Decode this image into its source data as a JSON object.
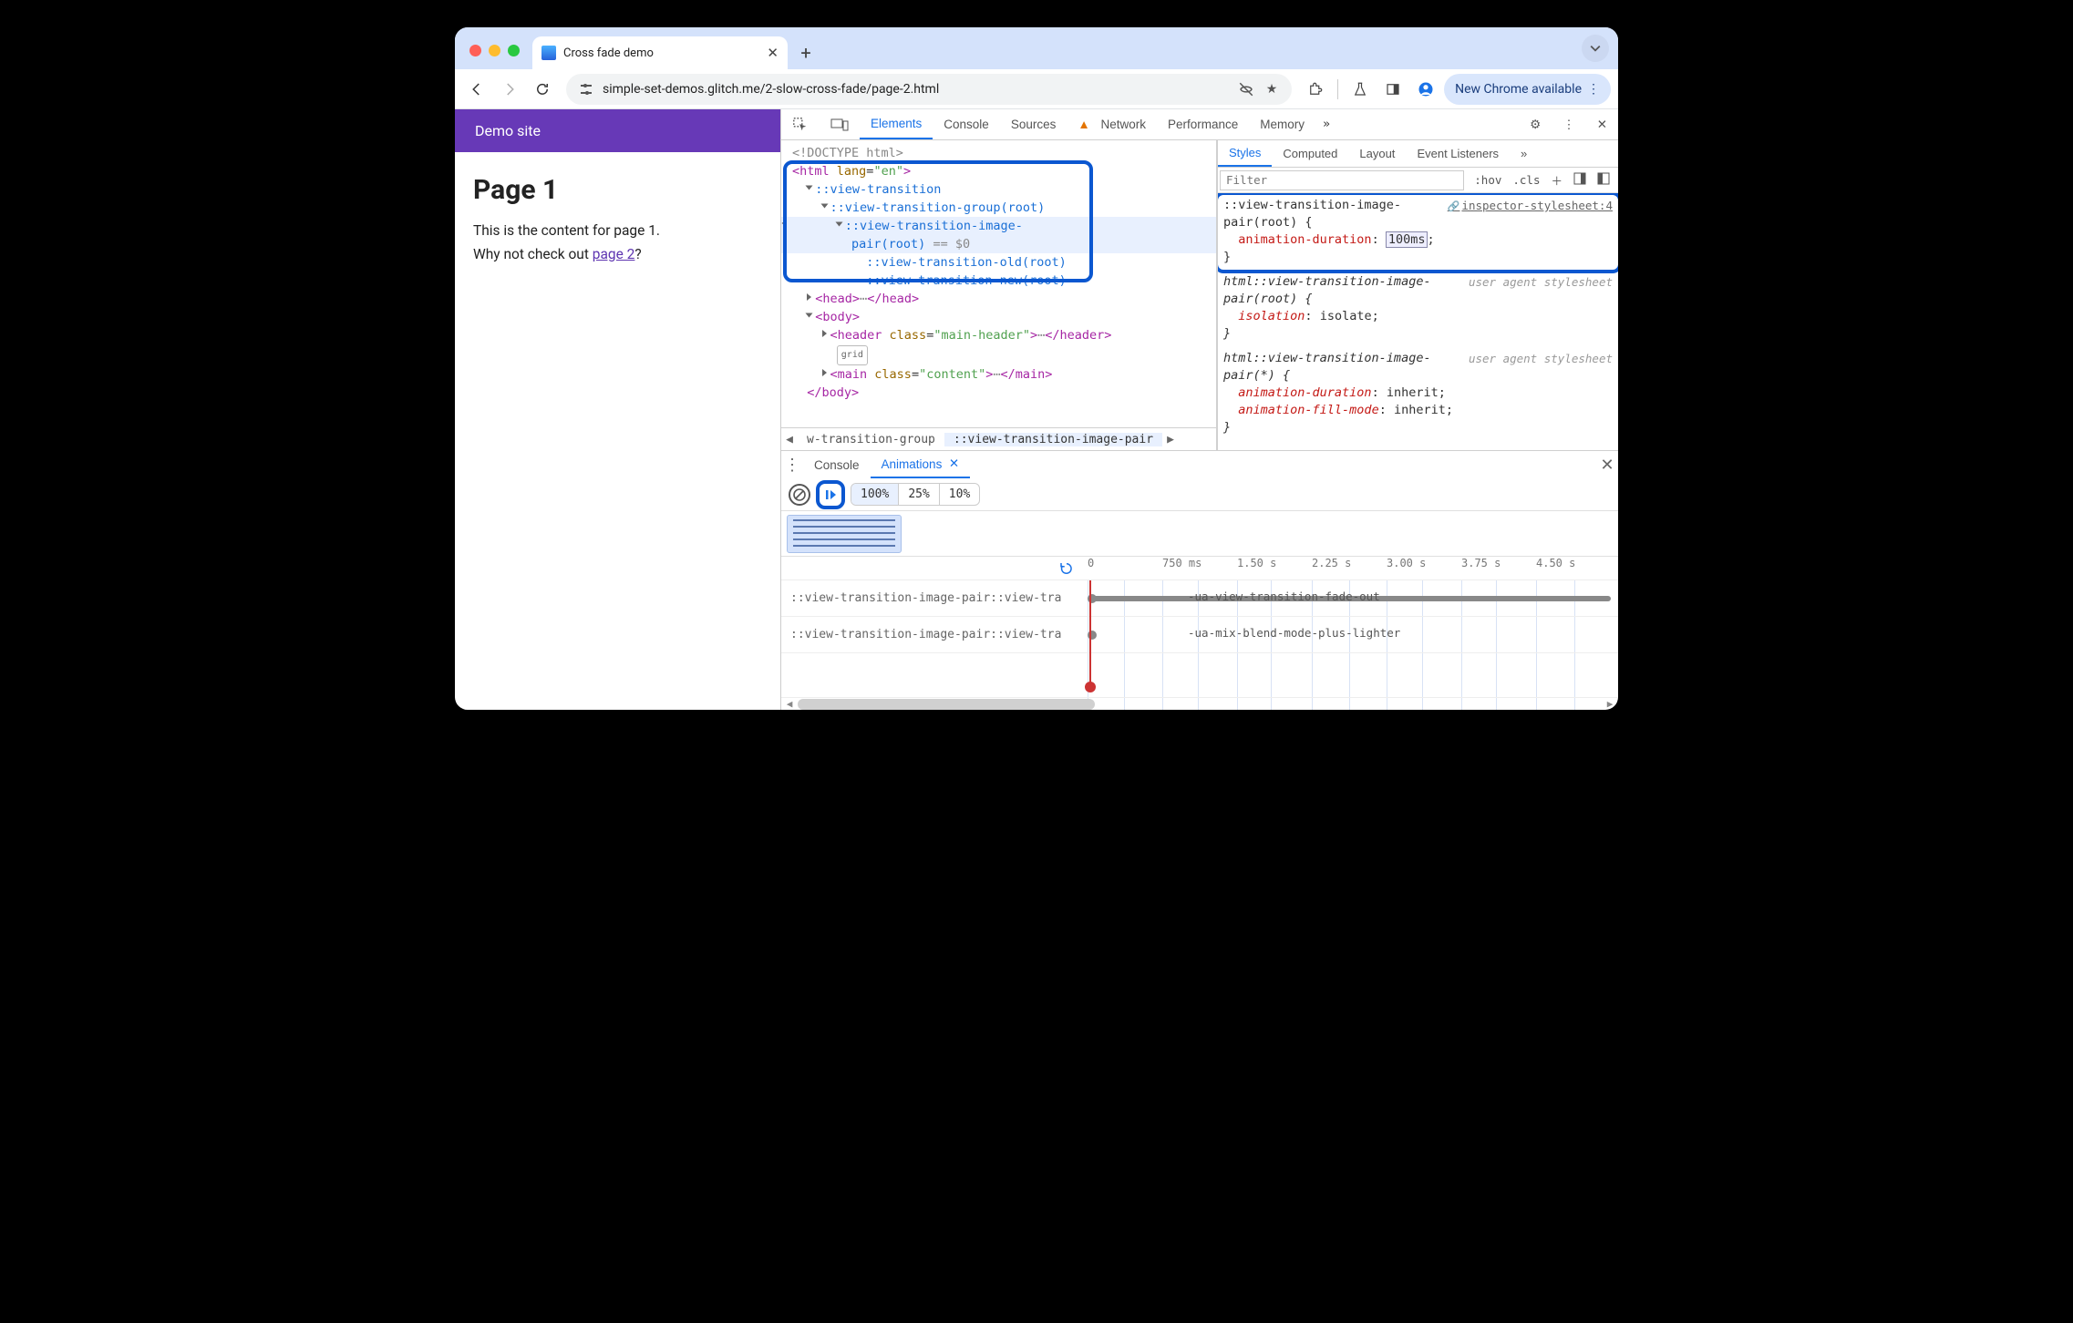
{
  "colors": {
    "highlight_box": "#0b57d0",
    "accent": "#1a73e8",
    "demo_header": "#6739b7"
  },
  "tab": {
    "title": "Cross fade demo"
  },
  "toolbar": {
    "url": "simple-set-demos.glitch.me/2-slow-cross-fade/page-2.html",
    "update_pill": "New Chrome available"
  },
  "page": {
    "site_title": "Demo site",
    "h1": "Page 1",
    "p1": "This is the content for page 1.",
    "p2_pre": "Why not check out ",
    "p2_link": "page 2",
    "p2_post": "?"
  },
  "devtools_tabs": [
    "Elements",
    "Console",
    "Sources",
    "Network",
    "Performance",
    "Memory"
  ],
  "styles_tabs": [
    "Styles",
    "Computed",
    "Layout",
    "Event Listeners"
  ],
  "elements": {
    "doctype": "<!DOCTYPE html>",
    "html_open": "<html lang=\"en\">",
    "vt1": "::view-transition",
    "vt2": "::view-transition-group(root)",
    "vt3a": "::view-transition-image-",
    "vt3b": "pair(root)",
    "vt3_sel": " == $0",
    "vt4": "::view-transition-old(root)",
    "vt5": "::view-transition-new(root)",
    "head": "<head>…</head>",
    "body_open": "<body>",
    "header": "<header class=\"main-header\">…</header>",
    "grid_badge": "grid",
    "main": "<main class=\"content\">…</main>",
    "body_close": "</body>"
  },
  "breadcrumb": {
    "b1": "w-transition-group",
    "b2": "::view-transition-image-pair"
  },
  "styles": {
    "filter_placeholder": "Filter",
    "hov": ":hov",
    "cls": ".cls",
    "r1_sel": "::view-transition-image-pair(root) {",
    "r1_link": "inspector-stylesheet:4",
    "r1_prop": "animation-duration",
    "r1_val": "100ms",
    "r2_sel": "html::view-transition-image-pair(root) {",
    "r2_ua": "user agent stylesheet",
    "r2_prop": "isolation",
    "r2_val": "isolate",
    "r3_sel": "html::view-transition-image-pair(*) {",
    "r3_ua": "user agent stylesheet",
    "r3_p1": "animation-duration",
    "r3_v1": "inherit",
    "r3_p2": "animation-fill-mode",
    "r3_v2": "inherit"
  },
  "drawer": {
    "console": "Console",
    "animations": "Animations",
    "speeds": [
      "100%",
      "25%",
      "10%"
    ],
    "ticks": [
      "0",
      "750 ms",
      "1.50 s",
      "2.25 s",
      "3.00 s",
      "3.75 s",
      "4.50 s"
    ],
    "track1_label": "::view-transition-image-pair::view-tra",
    "track1_name": "-ua-view-transition-fade-out",
    "track2_label": "::view-transition-image-pair::view-tra",
    "track2_name": "-ua-mix-blend-mode-plus-lighter"
  }
}
